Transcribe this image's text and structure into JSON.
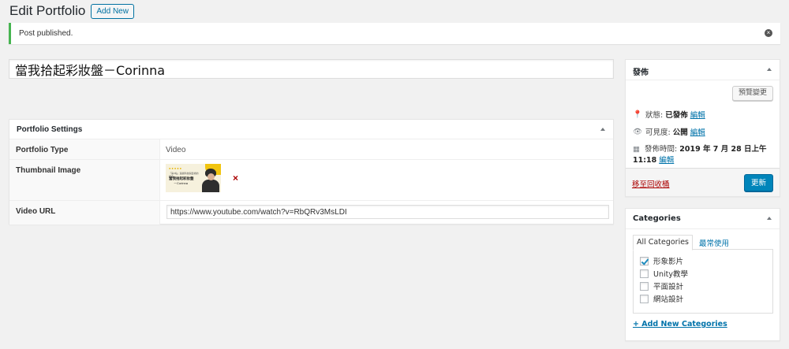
{
  "header": {
    "title": "Edit Portfolio",
    "add_new": "Add New"
  },
  "notice": {
    "text": "Post published.",
    "dismiss_icon": "close-circle-icon",
    "accent": "#46b450"
  },
  "post": {
    "title": "當我拾起彩妝盤－Corinna"
  },
  "portfolio_settings": {
    "title": "Portfolio Settings",
    "rows": [
      {
        "label": "Portfolio Type",
        "value": "Video"
      },
      {
        "label": "Thumbnail Image",
        "thumb_line1": "「第3站」遊戲科技與藝術的結合",
        "thumb_line2": "當我拾起彩妝盤",
        "thumb_line3": "－Corinna",
        "remove": "×"
      },
      {
        "label": "Video URL",
        "value": "https://www.youtube.com/watch?v=RbQRv3MsLDI"
      }
    ]
  },
  "publish": {
    "title": "發佈",
    "preview": "預覽變更",
    "status_label": "狀態:",
    "status_value": "已發佈",
    "visibility_label": "可見度:",
    "visibility_value": "公開",
    "date_label": "發佈時間:",
    "date_value": "2019 年 7 月 28 日上午 11:18",
    "edit": "編輯",
    "trash": "移至回收桶",
    "update": "更新",
    "primary_color": "#0085ba"
  },
  "categories": {
    "title": "Categories",
    "tabs": [
      "All Categories",
      "最常使用"
    ],
    "items": [
      {
        "label": "形象影片",
        "checked": true
      },
      {
        "label": "Unity教學",
        "checked": false
      },
      {
        "label": "平面設計",
        "checked": false
      },
      {
        "label": "網站設計",
        "checked": false
      }
    ],
    "add_new": "+ Add New Categories"
  }
}
